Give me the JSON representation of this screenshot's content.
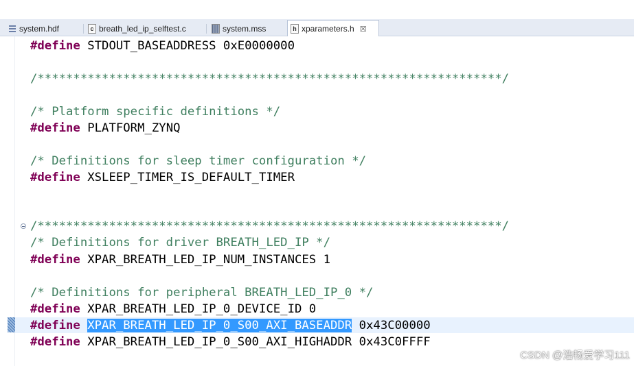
{
  "tabs": [
    {
      "label": "system.hdf",
      "icon": "hdf-file-icon"
    },
    {
      "label": "breath_led_ip_selftest.c",
      "icon": "c-file-icon",
      "icon_glyph": "c"
    },
    {
      "label": "system.mss",
      "icon": "mss-file-icon"
    },
    {
      "label": "xparameters.h",
      "icon": "h-file-icon",
      "icon_glyph": "h",
      "close": "☒"
    }
  ],
  "editor": {
    "define_kw": "#define",
    "lines": {
      "l1_name": " STDOUT_BASEADDRESS 0xE0000000",
      "l2_stars": "/*****************************************************************/",
      "l3_comment": "/* Platform specific definitions */",
      "l4_name": " PLATFORM_ZYNQ",
      "l5_comment": "/* Definitions for sleep timer configuration */",
      "l6_name": " XSLEEP_TIMER_IS_DEFAULT_TIMER",
      "l7_stars": "/*****************************************************************/",
      "l8_comment": "/* Definitions for driver BREATH_LED_IP */",
      "l9_name": " XPAR_BREATH_LED_IP_NUM_INSTANCES 1",
      "l10_comment": "/* Definitions for peripheral BREATH_LED_IP_0 */",
      "l11_name": " XPAR_BREATH_LED_IP_0_DEVICE_ID 0",
      "l12_selected": "XPAR_BREATH_LED_IP_0_S00_AXI_BASEADDR",
      "l12_value": " 0x43C00000",
      "l13_name": " XPAR_BREATH_LED_IP_0_S00_AXI_HIGHADDR 0x43C0FFFF"
    }
  },
  "watermark": "CSDN @浩畅爱学习111",
  "colors": {
    "keyword": "#7f0055",
    "comment": "#3f7f5f",
    "selection": "#3399ff",
    "current_line": "#e8f2fe"
  }
}
